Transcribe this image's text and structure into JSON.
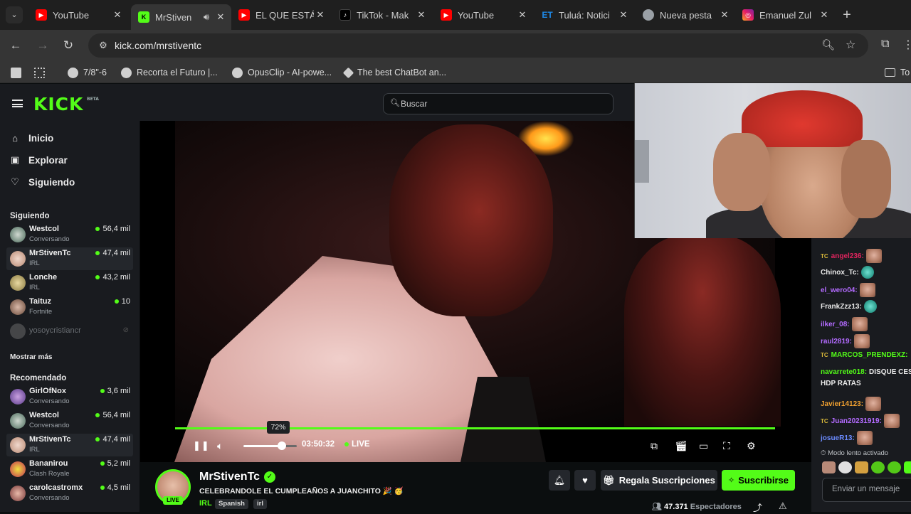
{
  "browser": {
    "tabs": [
      {
        "title": "YouTube",
        "icon": "youtube-icon"
      },
      {
        "title": "MrStiven",
        "icon": "kick-icon",
        "active": true,
        "audio": true
      },
      {
        "title": "EL QUE ESTÁ",
        "icon": "youtube-icon"
      },
      {
        "title": "TikTok - Mak",
        "icon": "tiktok-icon"
      },
      {
        "title": "YouTube",
        "icon": "youtube-icon"
      },
      {
        "title": "Tuluá: Notici",
        "icon": "et-icon",
        "fav_text": "ET"
      },
      {
        "title": "Nueva pesta",
        "icon": "chrome-icon"
      },
      {
        "title": "Emanuel Zul",
        "icon": "instagram-icon"
      }
    ],
    "url": "kick.com/mrstiventc",
    "bookmarks": [
      {
        "label": "7/8\"-6"
      },
      {
        "label": "Recorta el Futuro |..."
      },
      {
        "label": "OpusClip - AI-powe..."
      },
      {
        "label": "The best ChatBot an..."
      },
      {
        "label": "To"
      }
    ]
  },
  "kick": {
    "logo": "KICK",
    "logo_sup": "BETA",
    "search_placeholder": "Buscar",
    "nav": [
      {
        "label": "Inicio",
        "icon": "home-icon"
      },
      {
        "label": "Explorar",
        "icon": "compass-icon"
      },
      {
        "label": "Siguiendo",
        "icon": "heart-icon"
      }
    ],
    "following_title": "Siguiendo",
    "following": [
      {
        "name": "Westcol",
        "category": "Conversando",
        "viewers": "56,4 mil"
      },
      {
        "name": "MrStivenTc",
        "category": "IRL",
        "viewers": "47,4 mil",
        "selected": true
      },
      {
        "name": "Lonche",
        "category": "IRL",
        "viewers": "43,2 mil"
      },
      {
        "name": "Taituz",
        "category": "Fortnite",
        "viewers": "10"
      },
      {
        "name": "yosoycristiancr",
        "category": "",
        "viewers": "",
        "offline": true
      }
    ],
    "show_more": "Mostrar más",
    "recommended_title": "Recomendado",
    "recommended": [
      {
        "name": "GirlOfNox",
        "category": "Conversando",
        "viewers": "3,6 mil"
      },
      {
        "name": "Westcol",
        "category": "Conversando",
        "viewers": "56,4 mil"
      },
      {
        "name": "MrStivenTc",
        "category": "IRL",
        "viewers": "47,4 mil",
        "selected": true
      },
      {
        "name": "Bananirou",
        "category": "Clash Royale",
        "viewers": "5,2 mil"
      },
      {
        "name": "carolcastromx",
        "category": "Conversando",
        "viewers": "4,5 mil"
      }
    ]
  },
  "player": {
    "volume_percent": 72,
    "volume_tooltip": "72%",
    "time": "03:50:32",
    "live_label": "LIVE"
  },
  "stream": {
    "name": "MrStivenTc",
    "title": "CELEBRANDOLE EL CUMPLEAÑOS A JUANCHITO 🎉 🥳",
    "category": "IRL",
    "tags": [
      "Spanish",
      "irl"
    ],
    "live_badge": "LIVE",
    "gift_label": "Regala Suscripciones",
    "subscribe_label": "Suscribirse",
    "viewers_count": "47.371",
    "viewers_label": "Espectadores"
  },
  "chat": {
    "messages": [
      {
        "user": "angel236:",
        "color": "#e0245e",
        "tc": true,
        "emote": true
      },
      {
        "user": "Chinox_Tc:",
        "color": "#eaeaea",
        "tc": false,
        "emote": "cyan"
      },
      {
        "user": "el_wero04:",
        "color": "#b36bff",
        "tc": false,
        "emote": true
      },
      {
        "user": "FrankZzz13:",
        "color": "#eaeaea",
        "tc": false,
        "emote": "cyan"
      },
      {
        "user": "ilker_08:",
        "color": "#b36bff",
        "tc": false,
        "emote": true
      },
      {
        "user": "raul2819:",
        "color": "#b36bff",
        "tc": false,
        "emote": true
      },
      {
        "user": "MARCOS_PRENDEXZ:",
        "color": "#53fc18",
        "tc": true,
        "emote": false
      },
      {
        "user": "navarrete018:",
        "color": "#53fc18",
        "tc": false,
        "text": "DISQUE CES"
      },
      {
        "user": "",
        "color": "#eaeaea",
        "tc": false,
        "text": "HDP RATAS"
      },
      {
        "user": "Javier14123:",
        "color": "#f0a030",
        "tc": false,
        "emote": true
      },
      {
        "user": "Juan20231919:",
        "color": "#b36bff",
        "tc": true,
        "emote": true
      },
      {
        "user": "josueR13:",
        "color": "#6b8bff",
        "tc": false,
        "emote": true
      }
    ],
    "slow_mode": "Modo lento activado",
    "input_placeholder": "Enviar un mensaje"
  },
  "colors": {
    "kick_green": "#53fc18",
    "sidebar_bg": "#191b1f",
    "page_bg": "#0b0e0f"
  }
}
